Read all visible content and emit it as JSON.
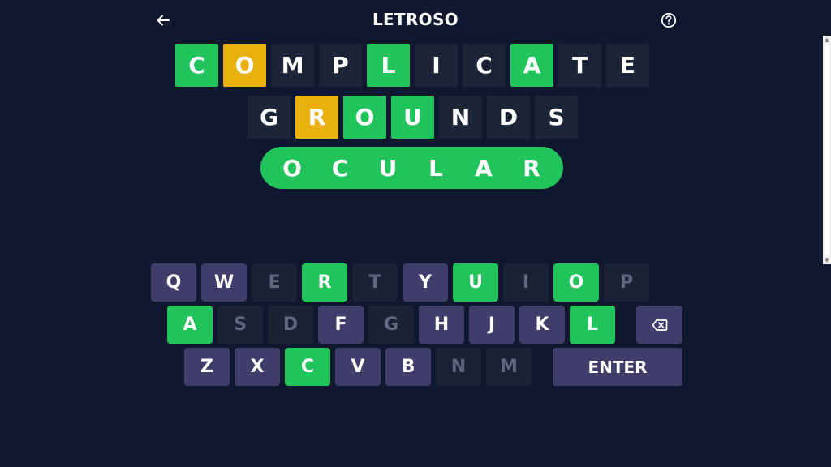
{
  "header": {
    "title": "LETROSO"
  },
  "colors": {
    "background": "#101830",
    "correct": "#21c35b",
    "present": "#e9b10e",
    "absent_tile": "#1c2538",
    "key_default": "#403d6b",
    "key_absent": "#1a2236"
  },
  "board": {
    "rows": [
      {
        "word": "COMPLICATE",
        "letters": [
          {
            "ch": "C",
            "state": "correct"
          },
          {
            "ch": "O",
            "state": "present"
          },
          {
            "ch": "M",
            "state": "absent"
          },
          {
            "ch": "P",
            "state": "absent"
          },
          {
            "ch": "L",
            "state": "correct"
          },
          {
            "ch": "I",
            "state": "absent"
          },
          {
            "ch": "C",
            "state": "absent"
          },
          {
            "ch": "A",
            "state": "correct"
          },
          {
            "ch": "T",
            "state": "absent"
          },
          {
            "ch": "E",
            "state": "absent"
          }
        ]
      },
      {
        "word": "GROUNDS",
        "letters": [
          {
            "ch": "G",
            "state": "absent"
          },
          {
            "ch": "R",
            "state": "present"
          },
          {
            "ch": "O",
            "state": "correct"
          },
          {
            "ch": "U",
            "state": "correct"
          },
          {
            "ch": "N",
            "state": "absent"
          },
          {
            "ch": "D",
            "state": "absent"
          },
          {
            "ch": "S",
            "state": "absent"
          }
        ]
      }
    ],
    "answer": {
      "word": "OCULAR",
      "letters": [
        "O",
        "C",
        "U",
        "L",
        "A",
        "R"
      ]
    }
  },
  "keyboard": {
    "row1": [
      {
        "label": "Q",
        "state": "default"
      },
      {
        "label": "W",
        "state": "default"
      },
      {
        "label": "E",
        "state": "absent"
      },
      {
        "label": "R",
        "state": "correct"
      },
      {
        "label": "T",
        "state": "absent"
      },
      {
        "label": "Y",
        "state": "default"
      },
      {
        "label": "U",
        "state": "correct"
      },
      {
        "label": "I",
        "state": "absent"
      },
      {
        "label": "O",
        "state": "correct"
      },
      {
        "label": "P",
        "state": "absent"
      }
    ],
    "row2": [
      {
        "label": "A",
        "state": "correct"
      },
      {
        "label": "S",
        "state": "absent"
      },
      {
        "label": "D",
        "state": "absent"
      },
      {
        "label": "F",
        "state": "default"
      },
      {
        "label": "G",
        "state": "absent"
      },
      {
        "label": "H",
        "state": "default"
      },
      {
        "label": "J",
        "state": "default"
      },
      {
        "label": "K",
        "state": "default"
      },
      {
        "label": "L",
        "state": "correct"
      }
    ],
    "row3": [
      {
        "label": "Z",
        "state": "default"
      },
      {
        "label": "X",
        "state": "default"
      },
      {
        "label": "C",
        "state": "correct"
      },
      {
        "label": "V",
        "state": "default"
      },
      {
        "label": "B",
        "state": "default"
      },
      {
        "label": "N",
        "state": "absent"
      },
      {
        "label": "M",
        "state": "absent"
      }
    ],
    "enter_label": "ENTER",
    "backspace_icon": "backspace-icon"
  },
  "icons": {
    "back": "arrow-left-icon",
    "help": "question-circle-icon"
  }
}
